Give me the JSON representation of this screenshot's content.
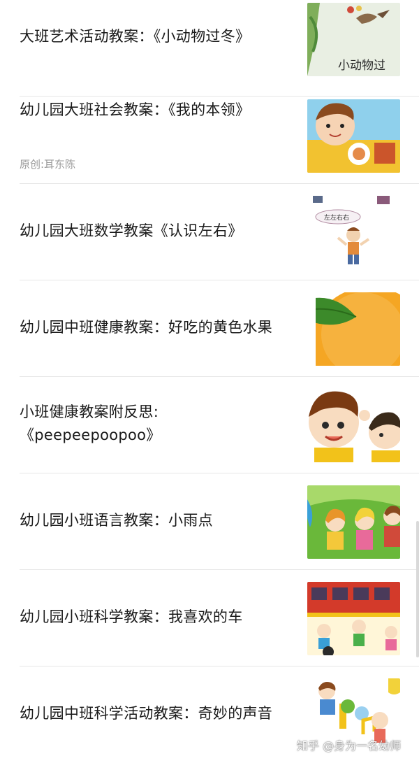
{
  "articles": [
    {
      "title": "大班艺术活动教案：《小动物过冬》",
      "thumb_text": "小动物过"
    },
    {
      "title": "幼儿园大班社会教案：《我的本领》",
      "meta": "原创:耳东陈"
    },
    {
      "title": "幼儿园大班数学教案《认识左右》",
      "thumb_text": "左左右右"
    },
    {
      "title": "幼儿园中班健康教案：好吃的黄色水果"
    },
    {
      "title_line1": "小班健康教案附反思:",
      "title_line2": "《peepeepoopoo》"
    },
    {
      "title": "幼儿园小班语言教案：小雨点"
    },
    {
      "title": "幼儿园小班科学教案：我喜欢的车"
    },
    {
      "title": "幼儿园中班科学活动教案：奇妙的声音"
    }
  ],
  "watermark": "知乎 @身为一名幼师"
}
